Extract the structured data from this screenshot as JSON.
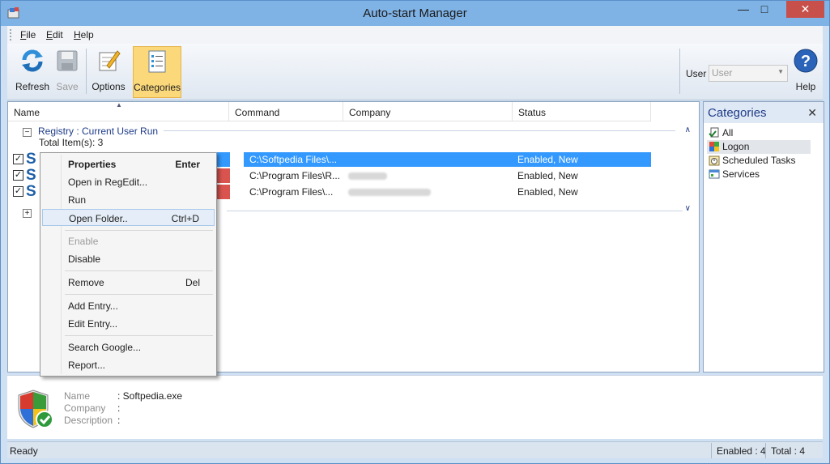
{
  "window": {
    "title": "Auto-start Manager"
  },
  "menu": [
    "File",
    "Edit",
    "Help"
  ],
  "toolbar": {
    "refresh": "Refresh",
    "save": "Save",
    "options": "Options",
    "categories": "Categories",
    "user_label": "User",
    "user_value": "User",
    "help": "Help"
  },
  "columns": [
    "Name",
    "Command",
    "Company",
    "Status"
  ],
  "group": {
    "title": "Registry : Current User Run",
    "count": "Total Item(s): 3"
  },
  "rows": [
    {
      "command": "C:\\Softpedia Files\\...",
      "status": "Enabled, New"
    },
    {
      "command": "C:\\Program Files\\R...",
      "status": "Enabled, New"
    },
    {
      "command": "C:\\Program Files\\...",
      "status": "Enabled, New"
    }
  ],
  "categories": {
    "title": "Categories",
    "items": [
      "All",
      "Logon",
      "Scheduled Tasks",
      "Services"
    ]
  },
  "details": {
    "name_label": "Name",
    "company_label": "Company",
    "description_label": "Description",
    "name_value": ": Softpedia.exe",
    "company_value": ":",
    "description_value": ":"
  },
  "context_menu": {
    "properties": "Properties",
    "properties_key": "Enter",
    "open_regedit": "Open in RegEdit...",
    "run": "Run",
    "open_folder": "Open Folder..",
    "open_folder_key": "Ctrl+D",
    "enable": "Enable",
    "disable": "Disable",
    "remove": "Remove",
    "remove_key": "Del",
    "add_entry": "Add Entry...",
    "edit_entry": "Edit Entry...",
    "search_google": "Search Google...",
    "report": "Report..."
  },
  "status": {
    "text": "Ready",
    "enabled": "Enabled : 4",
    "total": "Total : 4"
  },
  "colors": {
    "selection": "#3399ff",
    "accent": "#1e3b88",
    "active_tool": "#fbd87a",
    "close_button": "#c7504b"
  }
}
